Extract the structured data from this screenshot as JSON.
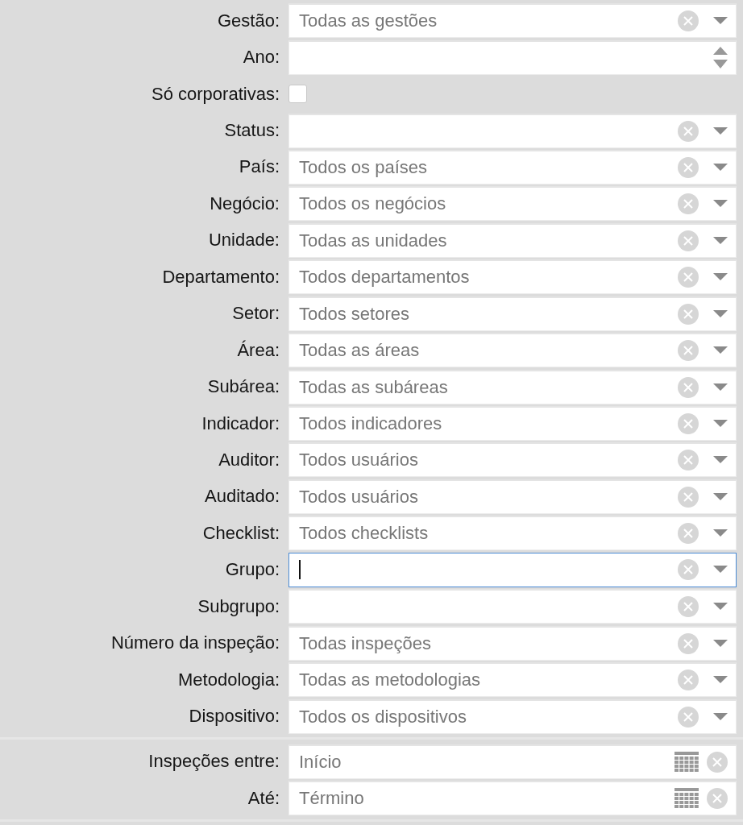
{
  "filters": [
    {
      "kind": "select",
      "label": "Gestão:",
      "placeholder": "Todas as gestões",
      "focused": false
    },
    {
      "kind": "number",
      "label": "Ano:"
    },
    {
      "kind": "checkbox",
      "label": "Só corporativas:",
      "checked": false
    },
    {
      "kind": "select",
      "label": "Status:",
      "focused": false
    },
    {
      "kind": "select",
      "label": "País:",
      "placeholder": "Todos os países",
      "focused": false
    },
    {
      "kind": "select",
      "label": "Negócio:",
      "placeholder": "Todos os negócios",
      "focused": false
    },
    {
      "kind": "select",
      "label": "Unidade:",
      "placeholder": "Todas as unidades",
      "focused": false
    },
    {
      "kind": "select",
      "label": "Departamento:",
      "placeholder": "Todos departamentos",
      "focused": false
    },
    {
      "kind": "select",
      "label": "Setor:",
      "placeholder": "Todos setores",
      "focused": false
    },
    {
      "kind": "select",
      "label": "Área:",
      "placeholder": "Todas as áreas",
      "focused": false
    },
    {
      "kind": "select",
      "label": "Subárea:",
      "placeholder": "Todas as subáreas",
      "focused": false
    },
    {
      "kind": "select",
      "label": "Indicador:",
      "placeholder": "Todos indicadores",
      "focused": false
    },
    {
      "kind": "select",
      "label": "Auditor:",
      "placeholder": "Todos usuários",
      "focused": false
    },
    {
      "kind": "select",
      "label": "Auditado:",
      "placeholder": "Todos usuários",
      "focused": false
    },
    {
      "kind": "select",
      "label": "Checklist:",
      "placeholder": "Todos checklists",
      "focused": false
    },
    {
      "kind": "select",
      "label": "Grupo:",
      "focused": true
    },
    {
      "kind": "select",
      "label": "Subgrupo:",
      "focused": false
    },
    {
      "kind": "select",
      "label": "Número da inspeção:",
      "placeholder": "Todas inspeções",
      "focused": false
    },
    {
      "kind": "select",
      "label": "Metodologia:",
      "placeholder": "Todas as metodologias",
      "focused": false
    },
    {
      "kind": "select",
      "label": "Dispositivo:",
      "placeholder": "Todos os dispositivos",
      "focused": false
    }
  ],
  "dates": [
    {
      "label": "Inspeções entre:",
      "placeholder": "Início"
    },
    {
      "label": "Até:",
      "placeholder": "Término"
    }
  ]
}
